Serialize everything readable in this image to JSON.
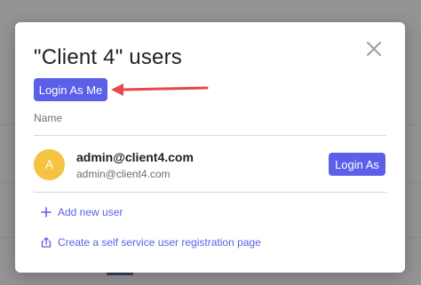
{
  "modal": {
    "title": "\"Client 4\" users",
    "login_as_me_label": "Login As Me",
    "column_header": "Name",
    "users": [
      {
        "avatar_initial": "A",
        "name": "admin@client4.com",
        "email": "admin@client4.com",
        "login_label": "Login As"
      }
    ],
    "add_user_label": "Add new user",
    "registration_link_label": "Create a self service user registration page"
  },
  "colors": {
    "accent": "#5c5fe8",
    "avatar": "#f5c242",
    "annotation_arrow": "#e5484d"
  },
  "icons": {
    "close": "close-icon",
    "add": "plus-icon",
    "share": "share-icon"
  }
}
